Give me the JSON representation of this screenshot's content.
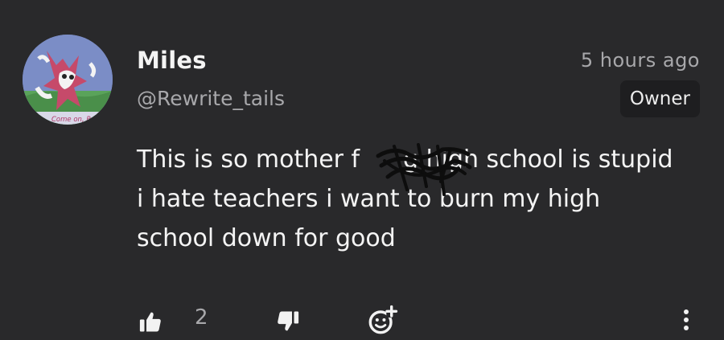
{
  "author": {
    "name": "Miles",
    "handle": "@Rewrite_tails",
    "avatar_caption": "Come on, Re"
  },
  "post": {
    "timestamp": "5 hours ago",
    "role_badge": "Owner",
    "text": "This is so mother f         g high school is stupid i hate teachers i want to burn my high school down for good"
  },
  "actions": {
    "like_count": "2",
    "icons": [
      "thumbs-up-icon",
      "thumbs-down-icon",
      "add-reaction-icon",
      "more-vertical-icon"
    ]
  },
  "colors": {
    "background": "#29292b",
    "text_primary": "#f4f4f4",
    "text_secondary": "#a8a8ab",
    "badge_background": "#1e1e20"
  }
}
